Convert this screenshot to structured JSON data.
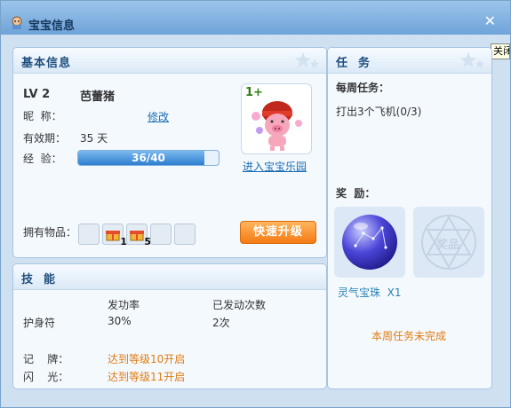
{
  "window": {
    "title": "宝宝信息",
    "close_label": "✕",
    "tooltip": "关闭"
  },
  "basic_info": {
    "heading": "基本信息",
    "level": "LV 2",
    "name": "芭蕾猪",
    "nickname_label": "昵  称：",
    "rename_link": "修改",
    "validity_label": "有效期：",
    "validity_value": "35 天",
    "exp_label": "经  验：",
    "exp_text": "36/40",
    "exp_fraction": 0.9,
    "pet_badge": "1+",
    "park_link": "进入宝宝乐园",
    "items_label": "拥有物品：",
    "items": [
      {
        "icon": "empty",
        "count": ""
      },
      {
        "icon": "gift-icon",
        "count": "1"
      },
      {
        "icon": "gift-icon",
        "count": "5"
      },
      {
        "icon": "empty",
        "count": ""
      },
      {
        "icon": "empty",
        "count": ""
      }
    ],
    "upgrade_button": "快速升级"
  },
  "skills": {
    "heading": "技  能",
    "col_rate": "发功率",
    "col_count": "已发动次数",
    "rows": [
      {
        "name": "护身符",
        "rate": "30%",
        "count": "2次"
      },
      {
        "name": "记    牌：",
        "status": "达到等级10开启"
      },
      {
        "name": "闪    光：",
        "status": "达到等级11开启"
      }
    ]
  },
  "tasks": {
    "heading": "任  务",
    "weekly_label": "每周任务：",
    "task_text": "打出3个飞机(0/3)",
    "reward_label": "奖  励：",
    "reward_item": "灵气宝珠  X1",
    "reward_placeholder": "奖品",
    "status": "本周任务未完成"
  },
  "colors": {
    "accent_blue": "#1a6cb3",
    "orange": "#e07c12",
    "title_bar": "#6fa3d8"
  }
}
